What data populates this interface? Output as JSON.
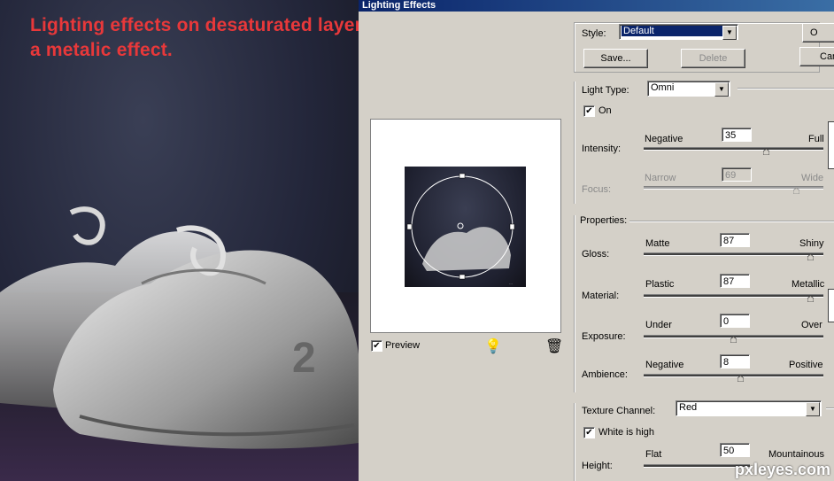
{
  "caption": {
    "line1": "Lighting effects on desaturated layer. Gives almost",
    "line2": "a metalic effect."
  },
  "dialog": {
    "title": "Lighting Effects",
    "style": {
      "label": "Style:",
      "value": "Default",
      "save": "Save...",
      "delete": "Delete"
    },
    "buttons": {
      "ok": "O",
      "cancel": "Car"
    },
    "light": {
      "type_label": "Light Type:",
      "type_value": "Omni",
      "on_label": "On",
      "on_checked": true,
      "intensity": {
        "label": "Intensity:",
        "left": "Negative",
        "right": "Full",
        "value": "35",
        "fraction": 0.68
      },
      "focus": {
        "label": "Focus:",
        "left": "Narrow",
        "right": "Wide",
        "value": "69",
        "fraction": 0.85,
        "disabled": true
      }
    },
    "properties": {
      "header": "Properties:",
      "gloss": {
        "label": "Gloss:",
        "left": "Matte",
        "right": "Shiny",
        "value": "87",
        "fraction": 0.93
      },
      "material": {
        "label": "Material:",
        "left": "Plastic",
        "right": "Metallic",
        "value": "87",
        "fraction": 0.93
      },
      "exposure": {
        "label": "Exposure:",
        "left": "Under",
        "right": "Over",
        "value": "0",
        "fraction": 0.5
      },
      "ambience": {
        "label": "Ambience:",
        "left": "Negative",
        "right": "Positive",
        "value": "8",
        "fraction": 0.54
      }
    },
    "texture": {
      "channel_label": "Texture Channel:",
      "channel_value": "Red",
      "white_is_high_label": "White is high",
      "white_is_high_checked": true,
      "height": {
        "label": "Height:",
        "left": "Flat",
        "right": "Mountainous",
        "value": "50"
      }
    },
    "preview": {
      "label": "Preview",
      "checked": true
    },
    "icons": {
      "light_bulb": "light-bulb-icon",
      "trash": "trash-icon"
    }
  },
  "watermark": "pxleyes.com",
  "colors": {
    "caption": "#e8383a",
    "titlebar": "#0a246a",
    "dialog_bg": "#d4d0c8"
  }
}
